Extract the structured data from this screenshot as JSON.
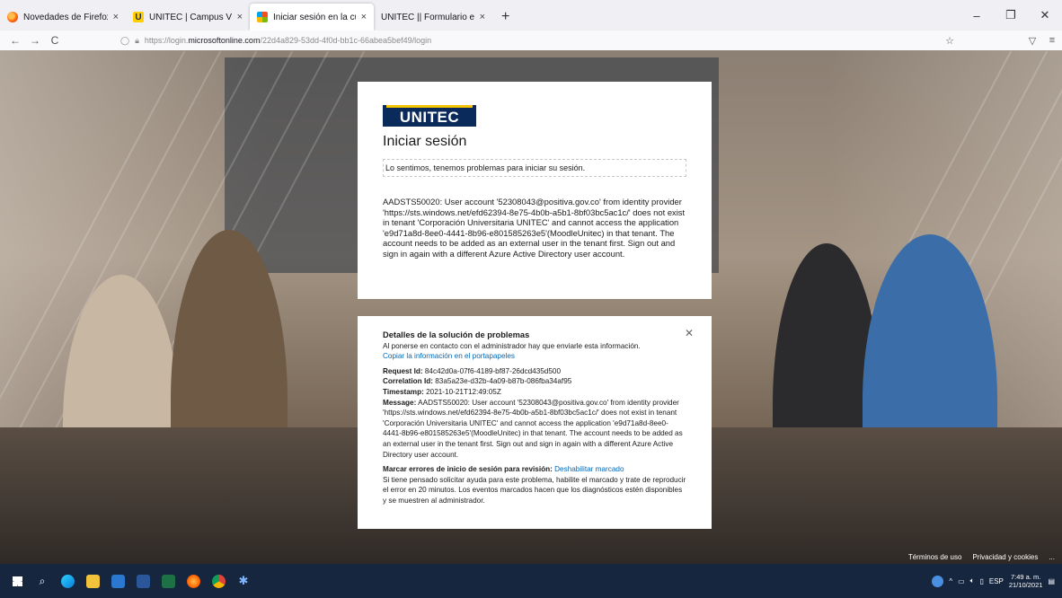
{
  "browser": {
    "tabs": [
      {
        "title": "Novedades de Firefox: más priv",
        "close": "×",
        "active": false
      },
      {
        "title": "UNITEC | Campus Virtual",
        "close": "×",
        "active": false
      },
      {
        "title": "Iniciar sesión en la cuenta",
        "close": "×",
        "active": true
      },
      {
        "title": "UNITEC || Formulario en línea",
        "close": "×",
        "active": false
      }
    ],
    "new_tab": "+",
    "url_prefix": "https://login.",
    "url_host": "microsoftonline.com",
    "url_path": "/22d4a829-53dd-4f0d-bb1c-66abea5bef49/login",
    "window_controls": {
      "minimize": "–",
      "maximize": "❐",
      "close": "✕"
    },
    "nav": {
      "back": "←",
      "forward": "→",
      "reload": "C"
    }
  },
  "login": {
    "logo_text": "UNITEC",
    "title": "Iniciar sesión",
    "error_summary": "Lo sentimos, tenemos problemas para iniciar su sesión.",
    "error_detail": "AADSTS50020: User account '52308043@positiva.gov.co' from identity provider 'https://sts.windows.net/efd62394-8e75-4b0b-a5b1-8bf03bc5ac1c/' does not exist in tenant 'Corporación Universitaria UNITEC' and cannot access the application 'e9d71a8d-8ee0-4441-8b96-e801585263e5'(MoodleUnitec) in that tenant. The account needs to be added as an external user in the tenant first. Sign out and sign in again with a different Azure Active Directory user account."
  },
  "troubleshooting": {
    "title": "Detalles de la solución de problemas",
    "subtitle": "Al ponerse en contacto con el administrador hay que enviarle esta información.",
    "copy_link": "Copiar la información en el portapapeles",
    "close": "✕",
    "request_id_label": "Request Id:",
    "request_id": "84c42d0a-07f6-4189-bf87-26dcd435d500",
    "correlation_id_label": "Correlation Id:",
    "correlation_id": "83a5a23e-d32b-4a09-b87b-086fba34af95",
    "timestamp_label": "Timestamp:",
    "timestamp": "2021-10-21T12:49:05Z",
    "message_label": "Message:",
    "message": "AADSTS50020: User account '52308043@positiva.gov.co' from identity provider 'https://sts.windows.net/efd62394-8e75-4b0b-a5b1-8bf03bc5ac1c/' does not exist in tenant 'Corporación Universitaria UNITEC' and cannot access the application 'e9d71a8d-8ee0-4441-8b96-e801585263e5'(MoodleUnitec) in that tenant. The account needs to be added as an external user in the tenant first. Sign out and sign in again with a different Azure Active Directory user account.",
    "flag_label": "Marcar errores de inicio de sesión para revisión:",
    "flag_link": "Deshabilitar marcado",
    "flag_text": "Si tiene pensado solicitar ayuda para este problema, habilite el marcado y trate de reproducir el error en 20 minutos. Los eventos marcados hacen que los diagnósticos estén disponibles y se muestren al administrador."
  },
  "footer": {
    "terms": "Términos de uso",
    "privacy": "Privacidad y cookies",
    "more": "..."
  },
  "taskbar": {
    "language": "ESP",
    "time": "7:49 a. m.",
    "date": "21/10/2021"
  },
  "colors": {
    "accent": "#0067b8",
    "logo_bg": "#0b2a5c",
    "logo_bar": "#f5c400",
    "taskbar": "#17263f"
  }
}
